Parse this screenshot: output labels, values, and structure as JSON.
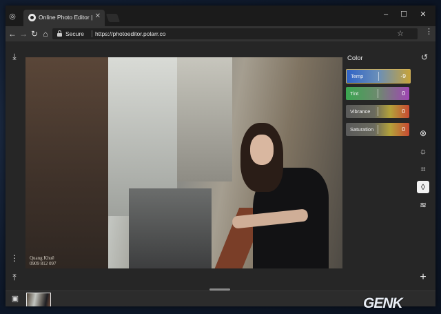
{
  "browser": {
    "tab_title": "Online Photo Editor | Pola",
    "tab_close": "✕",
    "window_controls": [
      "–",
      "☐",
      "✕"
    ],
    "nav": {
      "back": "←",
      "forward": "→",
      "reload": "↻",
      "home": "⌂"
    },
    "security_label": "Secure",
    "url": "https://photoeditor.polarr.co",
    "bookmark_icon": "star-icon",
    "menu_icon": "⋮"
  },
  "editor": {
    "panel_title": "Color",
    "sliders": [
      {
        "label": "Temp",
        "value": "-9",
        "color": "#3b6fc9"
      },
      {
        "label": "Tint",
        "value": "0",
        "color": "#3aa650"
      },
      {
        "label": "Vibrance",
        "value": "0",
        "color": "#555555"
      },
      {
        "label": "Saturation",
        "value": "0",
        "color": "#555555"
      }
    ],
    "photo_watermark": {
      "line1": "Quang Khuê",
      "line2": "0909 812 097"
    },
    "left_tools": {
      "download": "⤓",
      "more": "⋮",
      "share": "⤒"
    },
    "right_tools": [
      "reset-icon",
      "color-icon",
      "light-icon",
      "crop-icon",
      "drop-icon",
      "layers-icon"
    ],
    "add_label": "+"
  },
  "brand": {
    "logo_text": "GENK"
  }
}
